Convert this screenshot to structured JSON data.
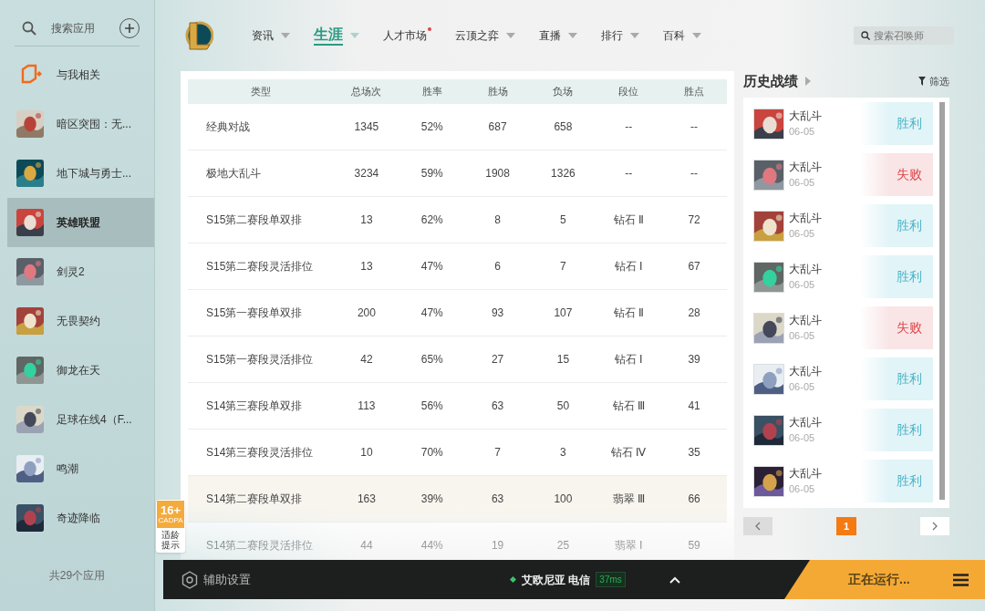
{
  "sidebar": {
    "search": {
      "placeholder": "搜索应用"
    },
    "items": [
      {
        "kind": "feed",
        "label": "与我相关",
        "selected": false
      },
      {
        "kind": "game",
        "label": "暗区突围：无...",
        "selected": false
      },
      {
        "kind": "game",
        "label": "地下城与勇士...",
        "selected": false
      },
      {
        "kind": "game",
        "label": "英雄联盟",
        "selected": true
      },
      {
        "kind": "game",
        "label": "剑灵2",
        "selected": false
      },
      {
        "kind": "game",
        "label": "无畏契约",
        "selected": false
      },
      {
        "kind": "game",
        "label": "御龙在天",
        "selected": false
      },
      {
        "kind": "game",
        "label": "足球在线4（F...",
        "selected": false
      },
      {
        "kind": "game",
        "label": "鸣潮",
        "selected": false
      },
      {
        "kind": "game",
        "label": "奇迹降临",
        "selected": false
      }
    ],
    "footer": "共29个应用"
  },
  "nav": {
    "tabs": [
      {
        "label": "资讯",
        "selected": false,
        "dropdown": true,
        "dot": false
      },
      {
        "label": "生涯",
        "selected": true,
        "dropdown": true,
        "dot": false
      },
      {
        "label": "人才市场",
        "selected": false,
        "dropdown": false,
        "dot": true
      },
      {
        "label": "云顶之弈",
        "selected": false,
        "dropdown": true,
        "dot": false
      },
      {
        "label": "直播",
        "selected": false,
        "dropdown": true,
        "dot": false
      },
      {
        "label": "排行",
        "selected": false,
        "dropdown": true,
        "dot": false
      },
      {
        "label": "百科",
        "selected": false,
        "dropdown": true,
        "dot": false
      }
    ],
    "search": {
      "placeholder": "搜索召唤师"
    }
  },
  "table": {
    "columns": [
      "类型",
      "总场次",
      "胜率",
      "胜场",
      "负场",
      "段位",
      "胜点"
    ],
    "rows": [
      {
        "selected": false,
        "cells": [
          "经典对战",
          "1345",
          "52%",
          "687",
          "658",
          "--",
          "--"
        ]
      },
      {
        "selected": false,
        "cells": [
          "极地大乱斗",
          "3234",
          "59%",
          "1908",
          "1326",
          "--",
          "--"
        ]
      },
      {
        "selected": false,
        "cells": [
          "S15第二赛段单双排",
          "13",
          "62%",
          "8",
          "5",
          "钻石 Ⅱ",
          "72"
        ]
      },
      {
        "selected": false,
        "cells": [
          "S15第二赛段灵活排位",
          "13",
          "47%",
          "6",
          "7",
          "钻石 Ⅰ",
          "67"
        ]
      },
      {
        "selected": false,
        "cells": [
          "S15第一赛段单双排",
          "200",
          "47%",
          "93",
          "107",
          "钻石 Ⅱ",
          "28"
        ]
      },
      {
        "selected": false,
        "cells": [
          "S15第一赛段灵活排位",
          "42",
          "65%",
          "27",
          "15",
          "钻石 Ⅰ",
          "39"
        ]
      },
      {
        "selected": false,
        "cells": [
          "S14第三赛段单双排",
          "113",
          "56%",
          "63",
          "50",
          "钻石 Ⅲ",
          "41"
        ]
      },
      {
        "selected": false,
        "cells": [
          "S14第三赛段灵活排位",
          "10",
          "70%",
          "7",
          "3",
          "钻石 Ⅳ",
          "35"
        ]
      },
      {
        "selected": true,
        "cells": [
          "S14第二赛段单双排",
          "163",
          "39%",
          "63",
          "100",
          "翡翠 Ⅲ",
          "66"
        ]
      },
      {
        "selected": false,
        "cells": [
          "S14第二赛段灵活排位",
          "44",
          "44%",
          "19",
          "25",
          "翡翠 Ⅰ",
          "59"
        ]
      }
    ]
  },
  "history": {
    "title": "历史战绩",
    "filter": "筛选",
    "matches": [
      {
        "mode": "大乱斗",
        "date": "06-05",
        "result": "胜利",
        "kind": "win"
      },
      {
        "mode": "大乱斗",
        "date": "06-05",
        "result": "失败",
        "kind": "loss"
      },
      {
        "mode": "大乱斗",
        "date": "06-05",
        "result": "胜利",
        "kind": "win"
      },
      {
        "mode": "大乱斗",
        "date": "06-05",
        "result": "胜利",
        "kind": "win"
      },
      {
        "mode": "大乱斗",
        "date": "06-05",
        "result": "失败",
        "kind": "loss"
      },
      {
        "mode": "大乱斗",
        "date": "06-05",
        "result": "胜利",
        "kind": "win"
      },
      {
        "mode": "大乱斗",
        "date": "06-05",
        "result": "胜利",
        "kind": "win"
      },
      {
        "mode": "大乱斗",
        "date": "06-05",
        "result": "胜利",
        "kind": "win"
      }
    ],
    "page": "1"
  },
  "age_badge": {
    "rating": "16+",
    "org": "CADPA",
    "caption": "适龄提示"
  },
  "bottom_bar": {
    "settings": "辅助设置",
    "server": "艾欧尼亚 电信",
    "ping": "37ms",
    "status": "正在运行..."
  }
}
